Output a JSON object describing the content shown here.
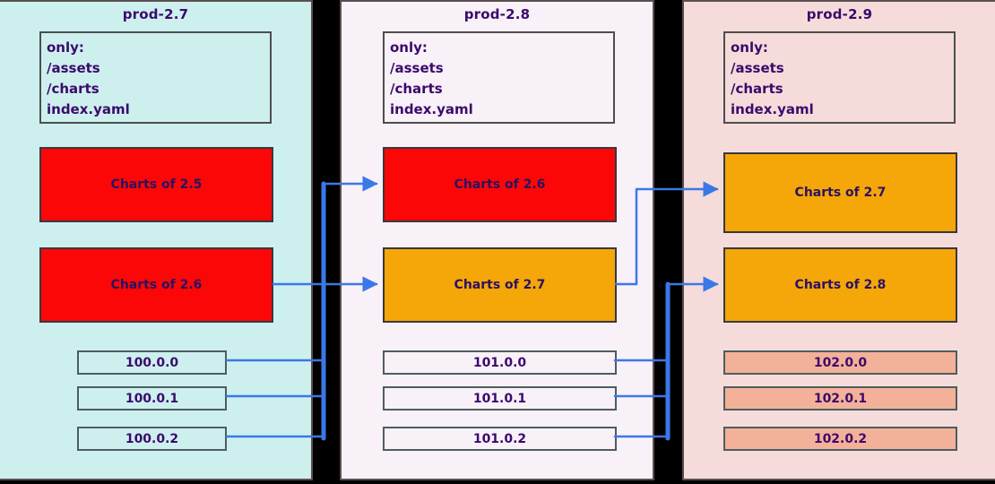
{
  "diagram": {
    "title_color": "#3b0a6b",
    "accent_arrow_color": "#3b78e7",
    "panels": [
      {
        "name": "prod-2.7",
        "bg": "#cdf0ef",
        "only_box": {
          "lines": [
            "only:",
            "/assets",
            "/charts",
            "index.yaml"
          ]
        },
        "charts": [
          {
            "label": "Charts of 2.5",
            "fill": "#fb0707"
          },
          {
            "label": "Charts of 2.6",
            "fill": "#fb0707"
          }
        ],
        "versions": [
          {
            "label": "100.0.0",
            "fill": "#cdf0ef"
          },
          {
            "label": "100.0.1",
            "fill": "#cdf0ef"
          },
          {
            "label": "100.0.2",
            "fill": "#cdf0ef"
          }
        ]
      },
      {
        "name": "prod-2.8",
        "bg": "#f8f1f8",
        "only_box": {
          "lines": [
            "only:",
            "/assets",
            "/charts",
            "index.yaml"
          ]
        },
        "charts": [
          {
            "label": "Charts of 2.6",
            "fill": "#fb0707"
          },
          {
            "label": "Charts of 2.7",
            "fill": "#f5a608"
          }
        ],
        "versions": [
          {
            "label": "101.0.0",
            "fill": "#f8f1f8"
          },
          {
            "label": "101.0.1",
            "fill": "#f8f1f8"
          },
          {
            "label": "101.0.2",
            "fill": "#f8f1f8"
          }
        ]
      },
      {
        "name": "prod-2.9",
        "bg": "#f5dcda",
        "only_box": {
          "lines": [
            "only:",
            "/assets",
            "/charts",
            "index.yaml"
          ]
        },
        "charts": [
          {
            "label": "Charts of 2.7",
            "fill": "#f5a608"
          },
          {
            "label": "Charts of 2.8",
            "fill": "#f5a608"
          }
        ],
        "versions": [
          {
            "label": "102.0.0",
            "fill": "#f4b199"
          },
          {
            "label": "102.0.1",
            "fill": "#f4b199"
          },
          {
            "label": "102.0.2",
            "fill": "#f4b199"
          }
        ]
      }
    ]
  }
}
